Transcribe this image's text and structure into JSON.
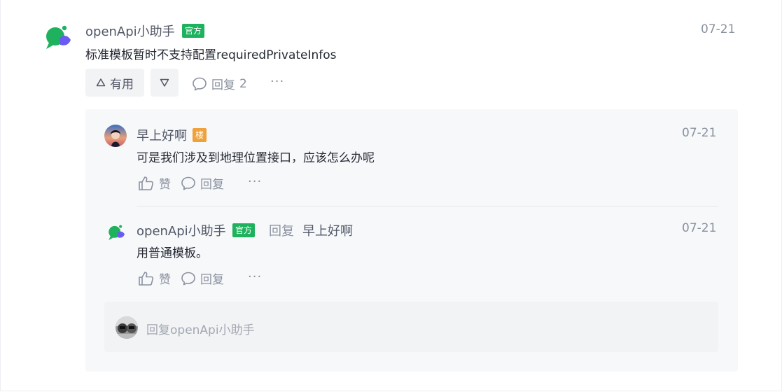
{
  "colors": {
    "official_tag": "#1fb25e",
    "floor_tag": "#f0a13a",
    "name": "#515767",
    "muted": "#8a919f"
  },
  "comment": {
    "author": "openApi小助手",
    "official_tag": "官方",
    "date": "07-21",
    "text": "标准模板暂时不支持配置requiredPrivateInfos",
    "useful_label": "有用",
    "reply_label": "回复",
    "reply_count": "2",
    "more": "···"
  },
  "replies": [
    {
      "author": "早上好啊",
      "floor_tag": "楼",
      "date": "07-21",
      "text": "可是我们涉及到地理位置接口，应该怎么办呢",
      "like_label": "赞",
      "reply_label": "回复",
      "more": "···"
    },
    {
      "author": "openApi小助手",
      "official_tag": "官方",
      "reply_word": "回复",
      "reply_to": "早上好啊",
      "date": "07-21",
      "text": "用普通模板。",
      "like_label": "赞",
      "reply_label": "回复",
      "more": "···"
    }
  ],
  "reply_input": {
    "placeholder": "回复openApi小助手"
  }
}
